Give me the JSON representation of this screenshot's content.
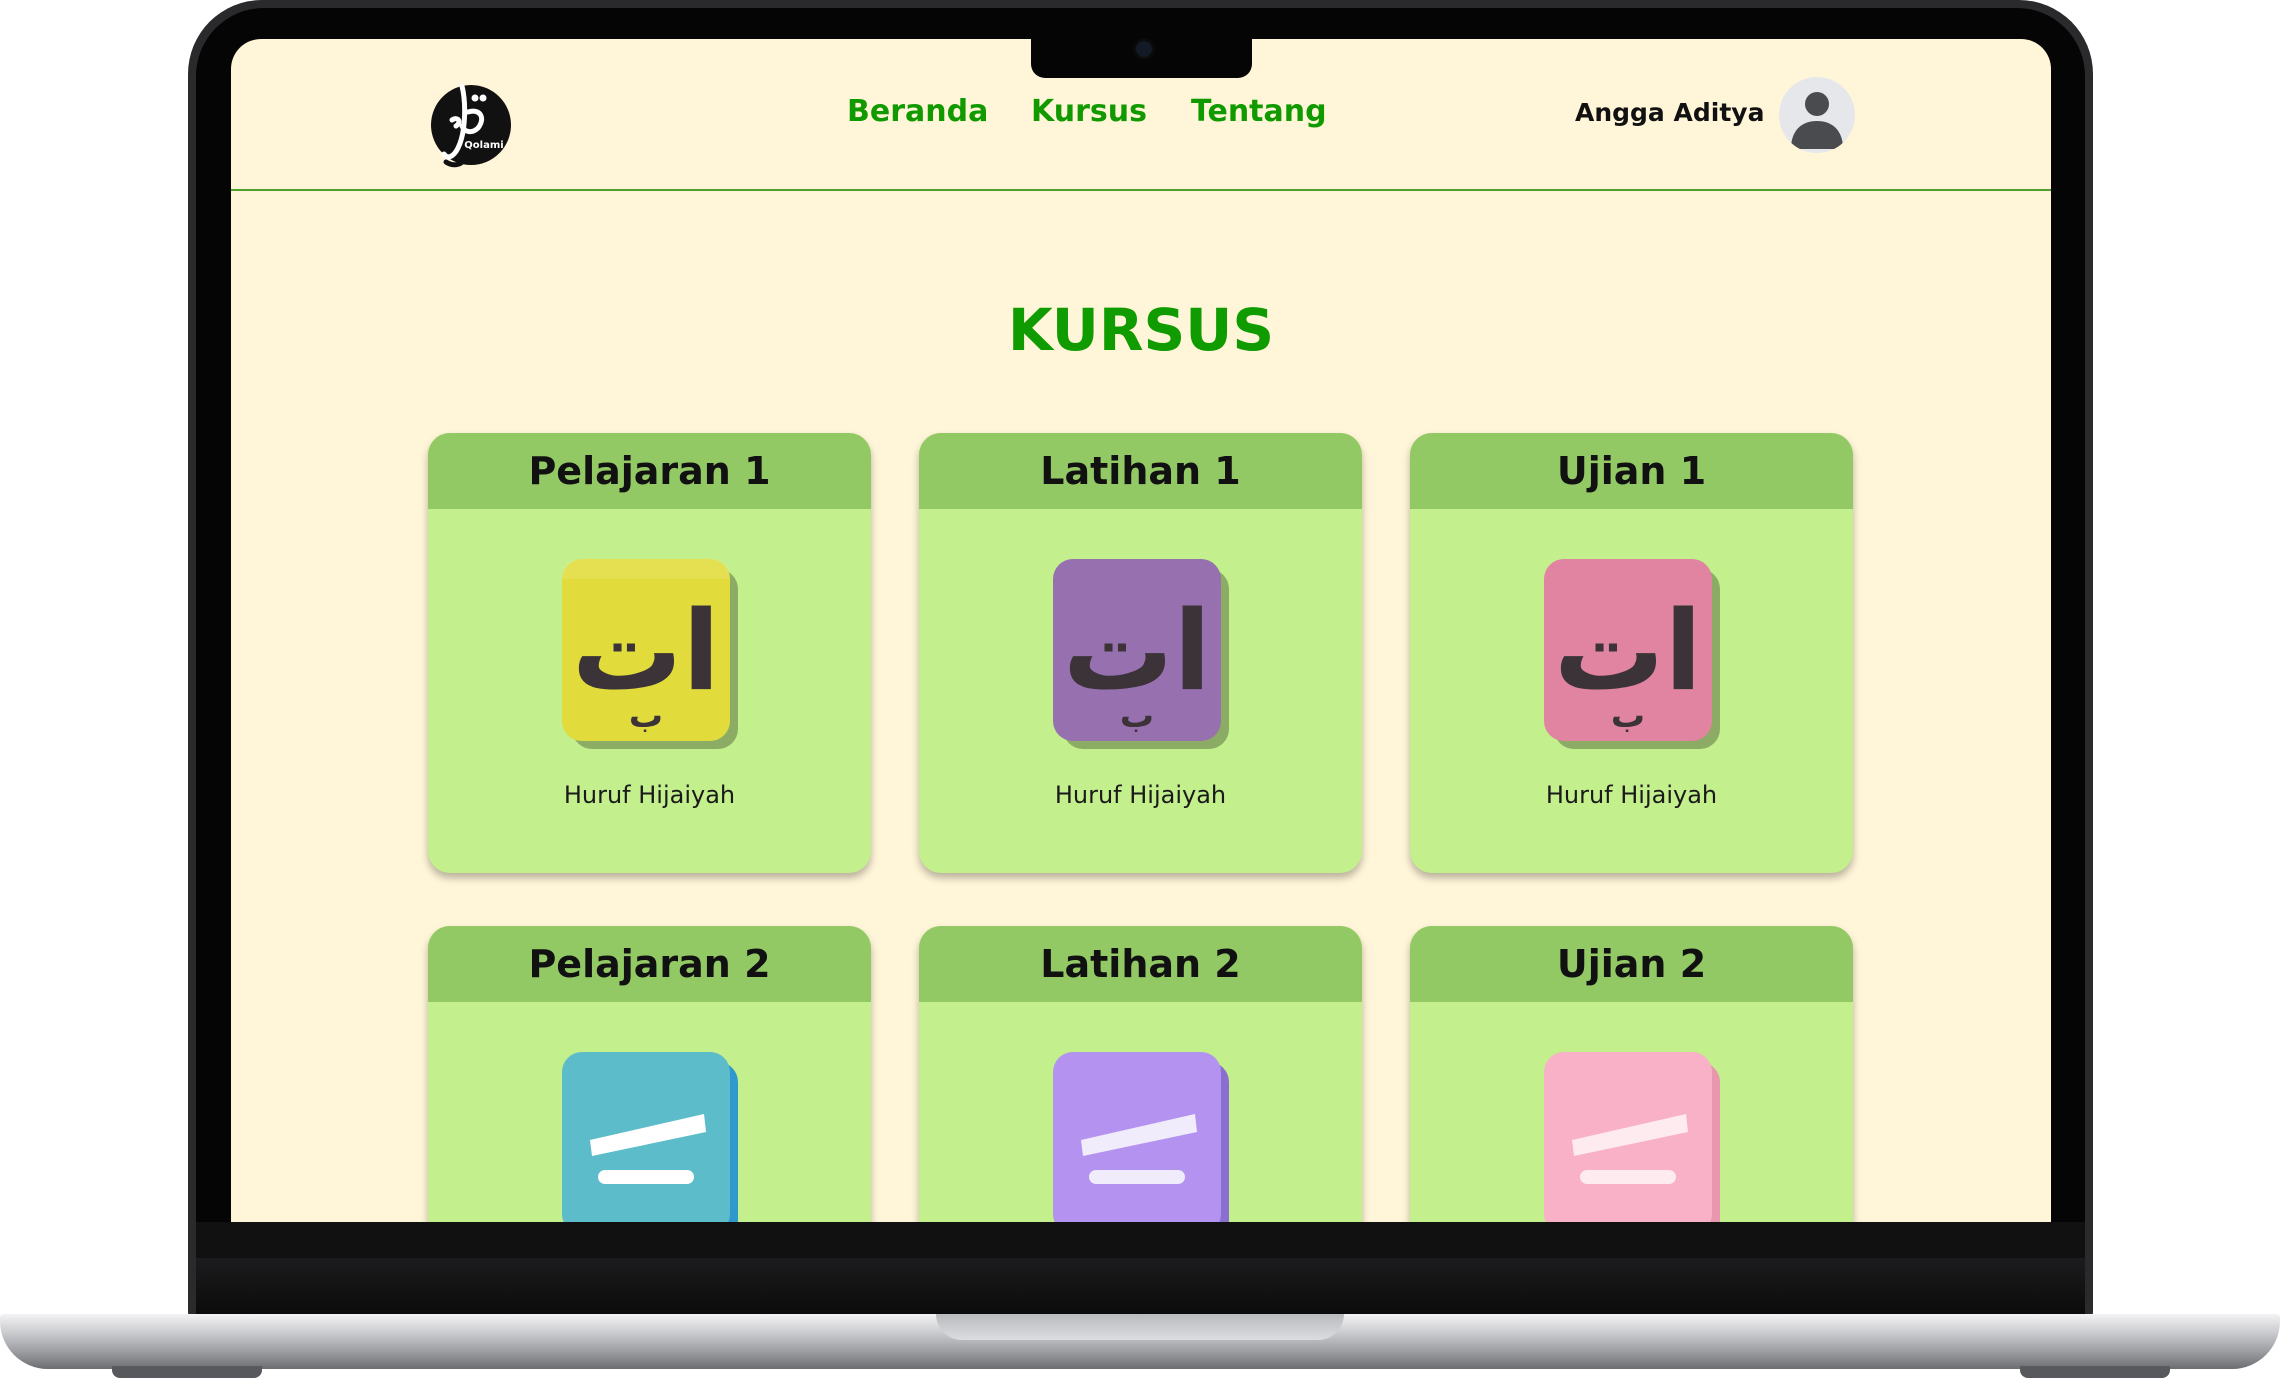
{
  "nav": {
    "logo_text": "Qolami",
    "links": [
      "Beranda",
      "Kursus",
      "Tentang"
    ],
    "user_name": "Angga Aditya"
  },
  "page": {
    "title": "KURSUS"
  },
  "cards": [
    {
      "title": "Pelajaran 1",
      "subtitle": "Huruf Hijaiyah",
      "icon": "hijaiyah-block-icon",
      "color": "#e1dc3b"
    },
    {
      "title": "Latihan 1",
      "subtitle": "Huruf Hijaiyah",
      "icon": "hijaiyah-block-icon",
      "color": "#9770b0"
    },
    {
      "title": "Ujian 1",
      "subtitle": "Huruf Hijaiyah",
      "icon": "hijaiyah-block-icon",
      "color": "#e084a1"
    },
    {
      "title": "Pelajaran 2",
      "icon": "harakat-block-icon",
      "color": "#5dbcc9"
    },
    {
      "title": "Latihan 2",
      "icon": "harakat-block-icon",
      "color": "#b393ef"
    },
    {
      "title": "Ujian 2",
      "icon": "harakat-block-icon",
      "color": "#f8b1c6"
    }
  ],
  "colors": {
    "accent": "#119a00",
    "background": "#fff5d8",
    "card": "#c3ef8d",
    "card_header": "#93c965"
  }
}
